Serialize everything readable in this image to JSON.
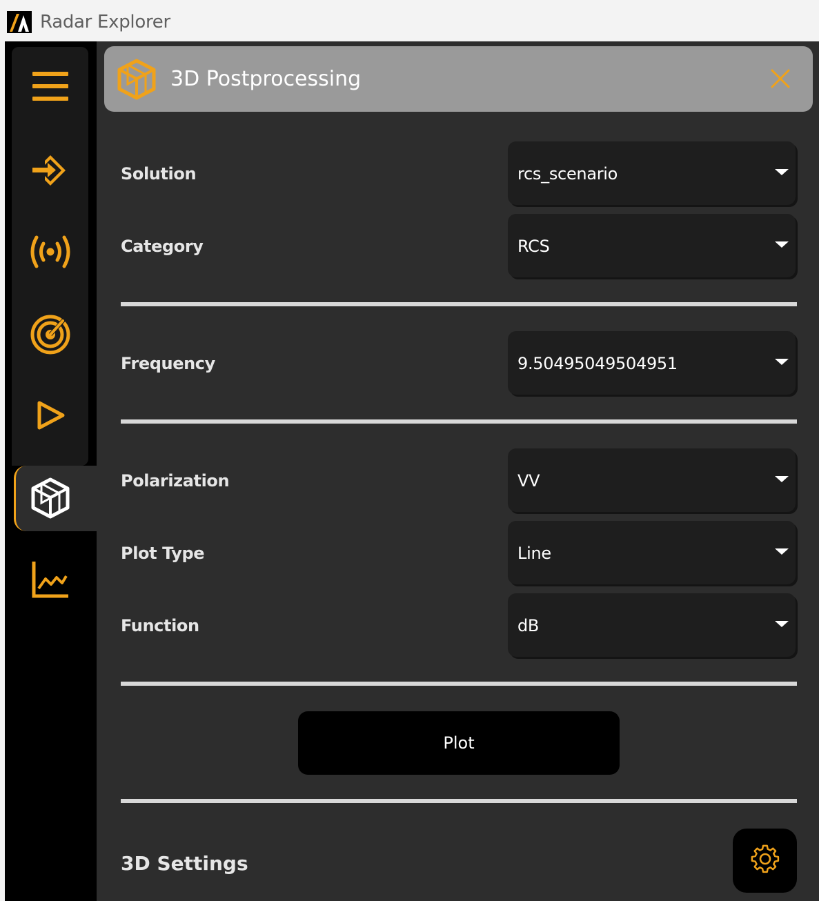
{
  "app": {
    "title": "Radar Explorer"
  },
  "colors": {
    "accent": "#f0a21a",
    "panel_bg": "#2d2d2d",
    "header_bg": "#9a9a9a",
    "sidebar_bg": "#000000"
  },
  "sidebar": {
    "items": [
      {
        "icon": "hamburger-menu-icon"
      },
      {
        "icon": "import-icon"
      },
      {
        "icon": "antenna-signal-icon"
      },
      {
        "icon": "radar-icon"
      },
      {
        "icon": "play-icon"
      },
      {
        "icon": "cube-3d-icon",
        "active": true
      },
      {
        "icon": "line-chart-icon"
      }
    ]
  },
  "panel": {
    "title": "3D Postprocessing",
    "icon": "cube-3d-icon",
    "close_icon": "close-icon"
  },
  "form": {
    "solution": {
      "label": "Solution",
      "value": "rcs_scenario"
    },
    "category": {
      "label": "Category",
      "value": "RCS"
    },
    "frequency": {
      "label": "Frequency",
      "value": "9.50495049504951"
    },
    "polarization": {
      "label": "Polarization",
      "value": "VV"
    },
    "plot_type": {
      "label": "Plot Type",
      "value": "Line"
    },
    "function": {
      "label": "Function",
      "value": "dB"
    }
  },
  "actions": {
    "plot_label": "Plot"
  },
  "settings": {
    "title": "3D Settings",
    "icon": "gear-icon"
  }
}
